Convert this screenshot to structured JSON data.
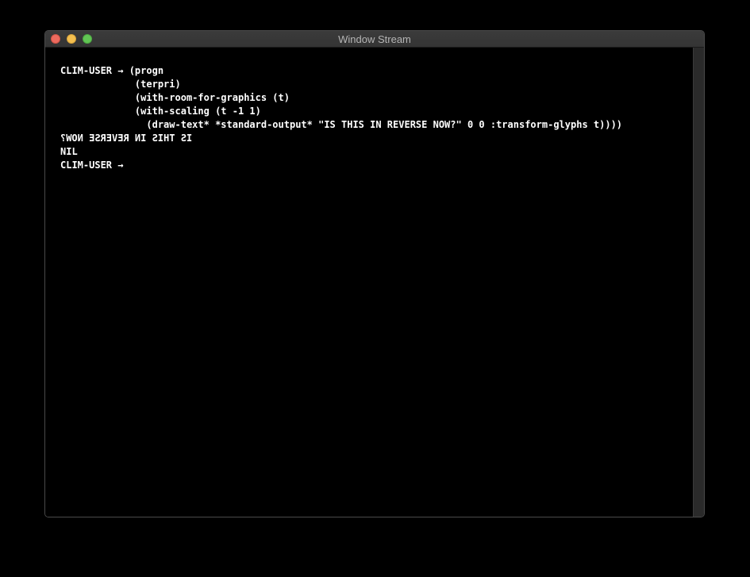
{
  "window": {
    "title": "Window Stream"
  },
  "listener": {
    "lines": [
      "CLIM-USER → (progn",
      "             (terpri)",
      "             (with-room-for-graphics (t)",
      "             (with-scaling (t -1 1)",
      "               (draw-text* *standard-output* \"IS THIS IN REVERSE NOW?\" 0 0 :transform-glyphs t))))",
      "IS THIS IN REVERSE NOW?",
      "NIL",
      "CLIM-USER → "
    ]
  }
}
